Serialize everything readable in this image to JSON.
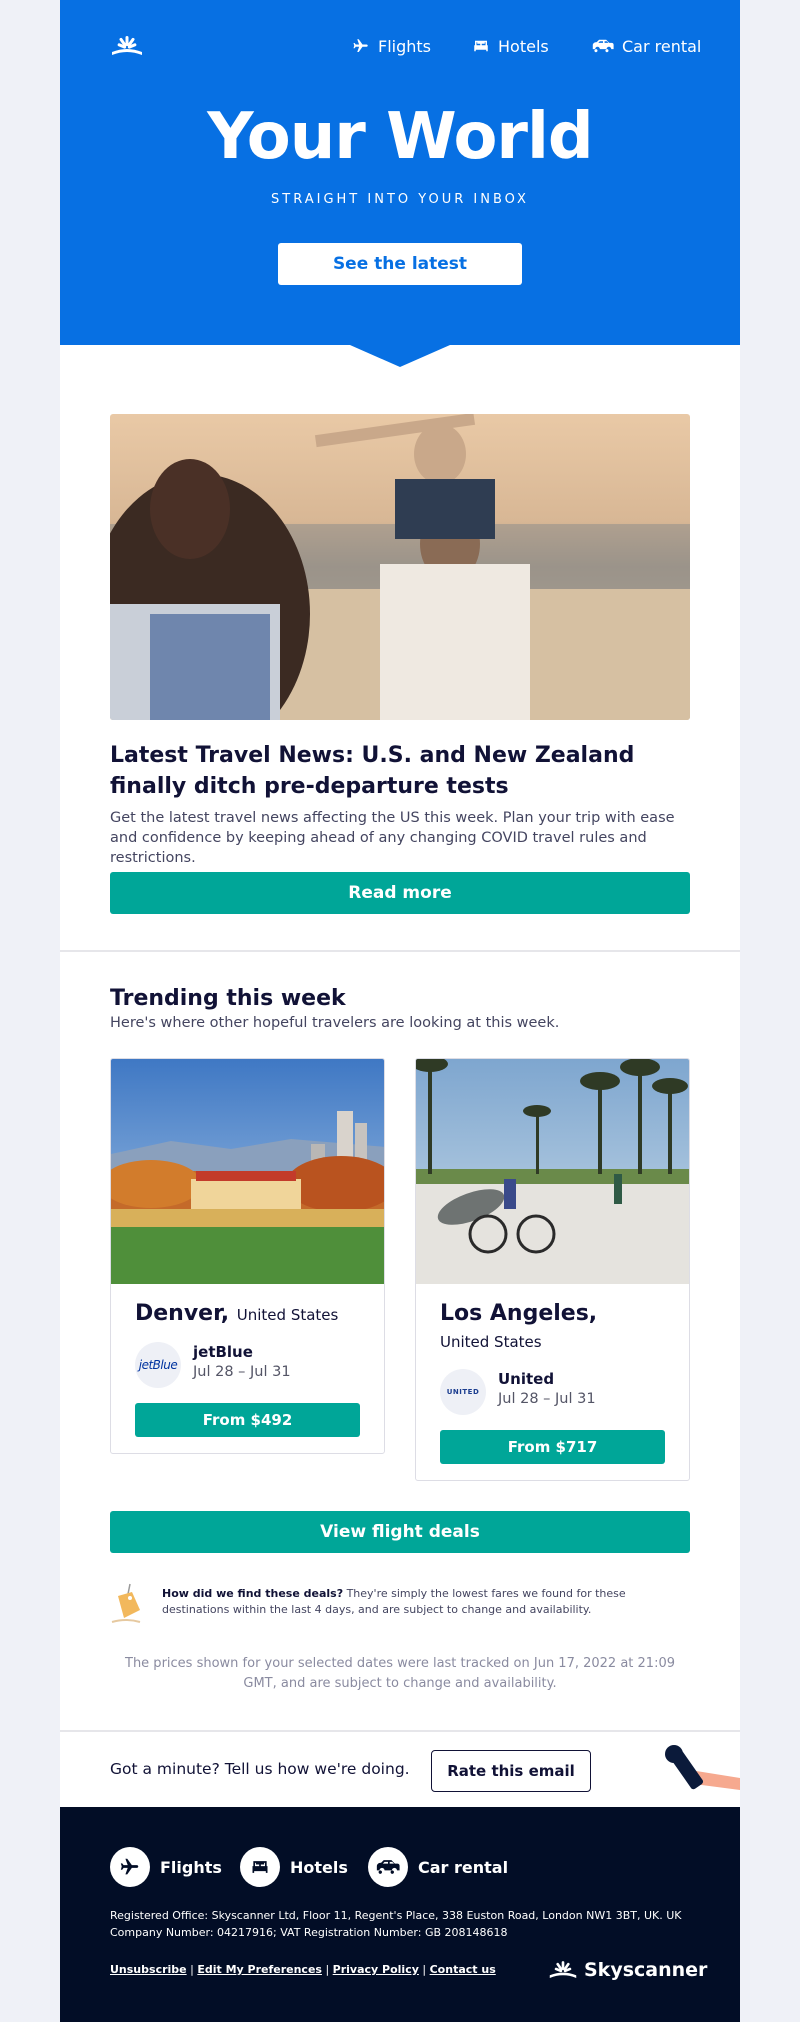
{
  "header": {
    "nav": [
      {
        "label": "Flights",
        "icon": "plane-icon"
      },
      {
        "label": "Hotels",
        "icon": "bed-icon"
      },
      {
        "label": "Car rental",
        "icon": "car-icon"
      }
    ],
    "title": "Your World",
    "subtitle": "STRAIGHT INTO YOUR INBOX",
    "cta": "See the latest"
  },
  "article": {
    "title": "Latest Travel News: U.S. and New Zealand finally ditch pre-departure tests",
    "body": "Get the latest travel news affecting the US this week. Plan your trip with ease and confidence by keeping ahead of any changing COVID travel rules and restrictions.",
    "cta": "Read more"
  },
  "trending": {
    "title": "Trending this week",
    "subtitle": "Here's where other hopeful travelers are looking at this week.",
    "cards": [
      {
        "city": "Denver,",
        "country": "United States",
        "airline": "jetBlue",
        "airline_logo_text": "jetBlue",
        "dates": "Jul 28 – Jul 31",
        "price": "From $492"
      },
      {
        "city": "Los Angeles,",
        "country": "United States",
        "airline": "United",
        "airline_logo_text": "UNITED",
        "dates": "Jul 28 – Jul 31",
        "price": "From $717"
      }
    ],
    "cta": "View flight deals",
    "note_bold": "How did we find these deals?",
    "note_text": " They're simply the lowest fares we found for these destinations within the last 4 days, and are subject to change and availability.",
    "tracked": "The prices shown for your selected dates were last tracked on Jun 17, 2022 at 21:09 GMT, and are subject to change and availability."
  },
  "feedback": {
    "text": "Got a minute? Tell us how we're doing.",
    "cta": "Rate this email"
  },
  "footer": {
    "nav": [
      {
        "label": "Flights"
      },
      {
        "label": "Hotels"
      },
      {
        "label": "Car rental"
      }
    ],
    "legal": "Registered Office: Skyscanner Ltd, Floor 11, Regent's Place, 338 Euston Road, London NW1 3BT, UK. UK Company Number: 04217916; VAT Registration Number: GB 208148618",
    "links": [
      "Unsubscribe",
      "Edit My Preferences",
      "Privacy Policy",
      "Contact us"
    ],
    "brand": "Skyscanner"
  },
  "colors": {
    "brand_blue": "#0770e3",
    "cta_green": "#00a698",
    "footer_navy": "#020d26"
  }
}
